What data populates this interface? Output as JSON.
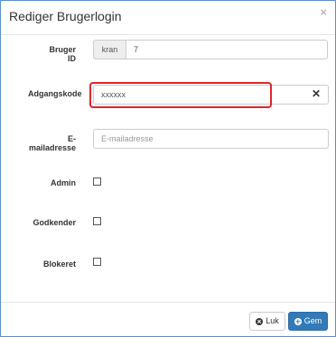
{
  "dialog": {
    "title": "Rediger Brugerlogin",
    "close_symbol": "×"
  },
  "form": {
    "user_id": {
      "label": "Bruger ID",
      "prefix": "kran",
      "value": "7"
    },
    "password": {
      "label": "Adgangskode",
      "value": "xxxxxx",
      "clear_symbol": "✕",
      "highlight_color": "#e0242b"
    },
    "email": {
      "label": "E-mailadresse",
      "value": "",
      "placeholder": "E-mailadresse"
    },
    "admin": {
      "label": "Admin",
      "checked": false
    },
    "approver": {
      "label": "Godkender",
      "checked": false
    },
    "blocked": {
      "label": "Blokeret",
      "checked": false
    }
  },
  "footer": {
    "close_label": "Luk",
    "close_icon": "times-circle-icon",
    "save_label": "Gem",
    "save_icon": "plus-circle-icon",
    "save_color": "#337ab7"
  }
}
